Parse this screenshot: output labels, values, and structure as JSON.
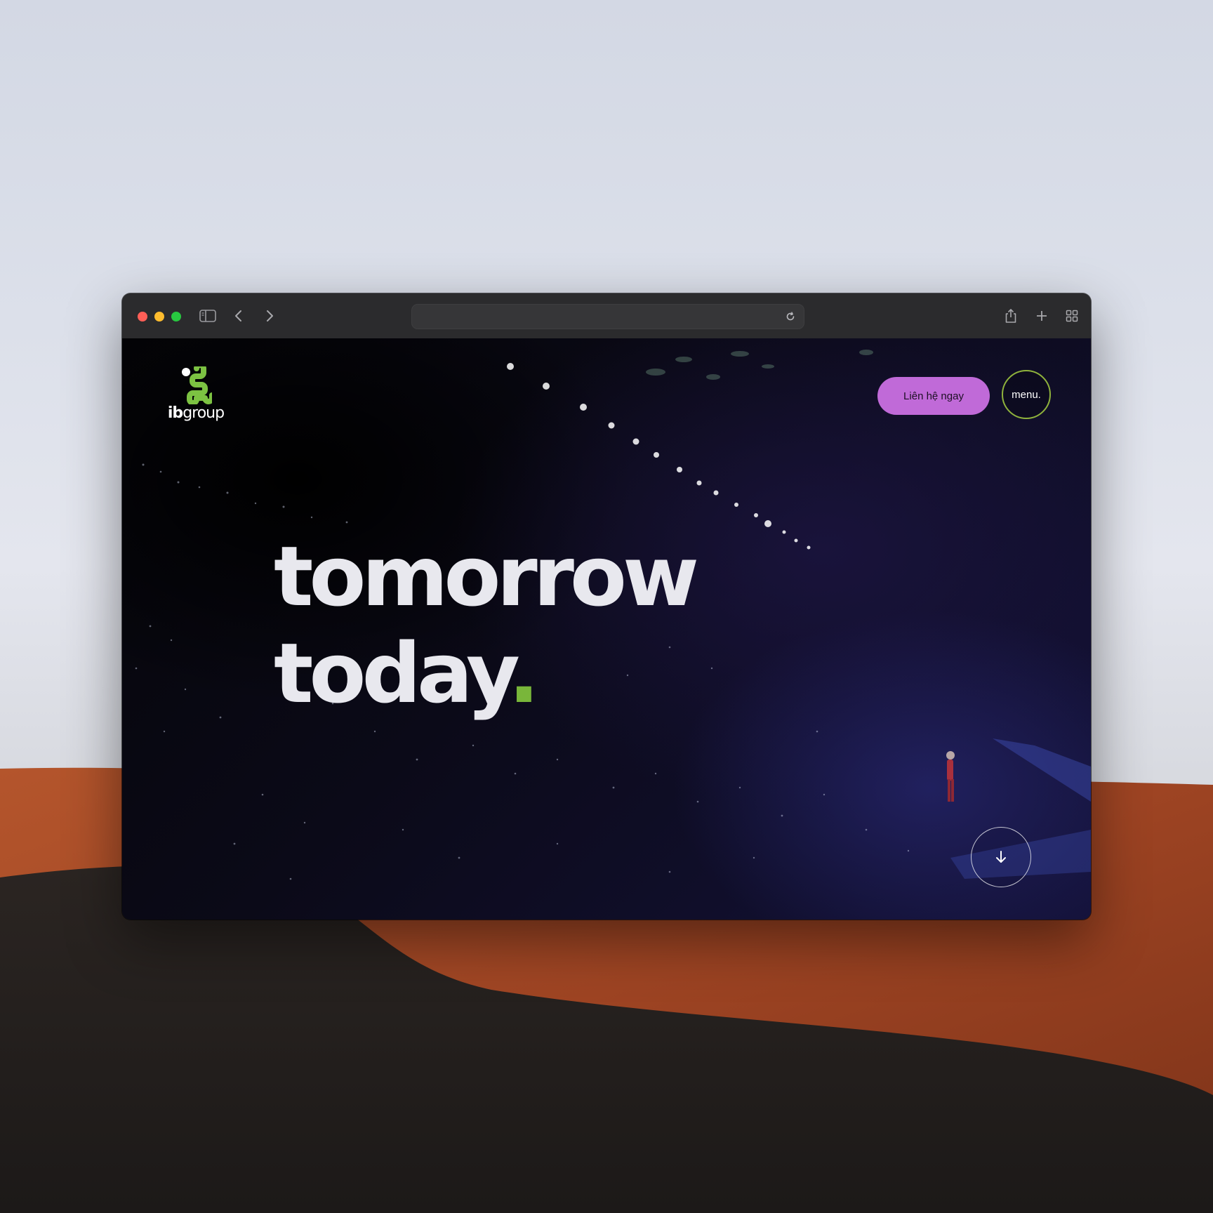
{
  "browser": {
    "address": "",
    "icons": [
      "sidebar-icon",
      "back-icon",
      "forward-icon",
      "reload-icon",
      "share-icon",
      "new-tab-icon",
      "tab-overview-icon"
    ]
  },
  "site": {
    "logo": {
      "text_bold": "ib",
      "text_regular": "group",
      "mark_color": "#7cc242"
    },
    "cta_label": "Liên hệ ngay",
    "menu_label": "menu.",
    "headline": {
      "line1": "tomorrow",
      "line2": "today",
      "accent": "."
    },
    "scroll_icon": "arrow-down-icon",
    "colors": {
      "cta": "#c06ad8",
      "menu_ring": "#8fb23c",
      "accent": "#79b63a"
    }
  }
}
